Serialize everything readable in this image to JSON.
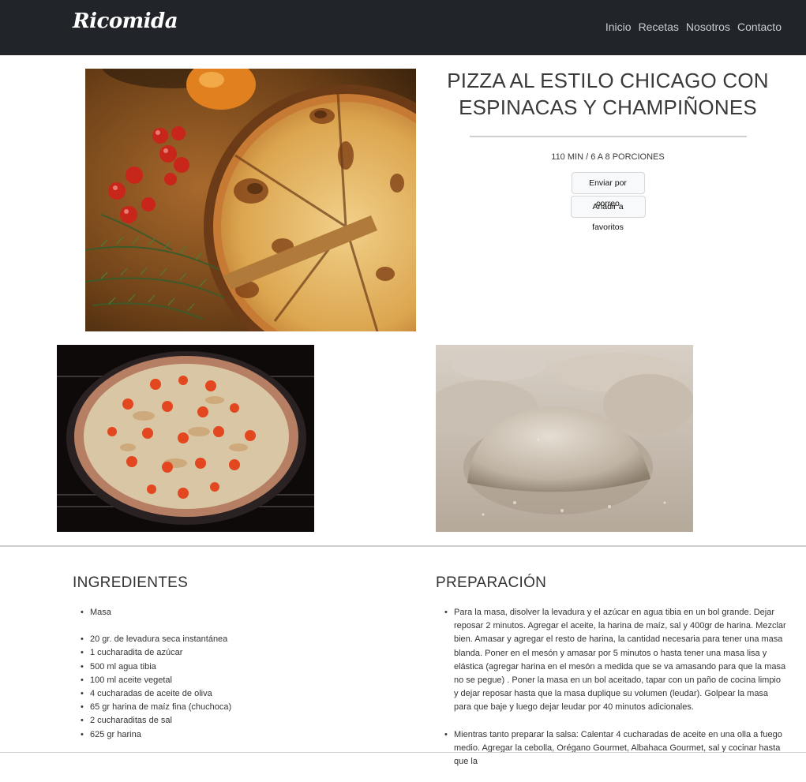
{
  "navbar": {
    "brand": "Ricomida",
    "links": [
      "Inicio",
      "Recetas",
      "Nosotros",
      "Contacto"
    ]
  },
  "recipe": {
    "title": "PIZZA AL ESTILO CHICAGO CON ESPINACAS Y CHAMPIÑONES",
    "meta": "110 MIN / 6 A 8 PORCIONES",
    "email_button": "Enviar por correo",
    "favorite_button": "Añadir a favoritos"
  },
  "ingredients": {
    "title": "INGREDIENTES",
    "items": [
      "Masa",
      "20 gr. de levadura seca instantánea",
      "1 cucharadita de azúcar",
      "500 ml agua tibia",
      "100 ml aceite vegetal",
      "4 cucharadas de aceite de oliva",
      "65 gr harina de maíz fina (chuchoca)",
      "2 cucharaditas de sal",
      "625 gr harina"
    ]
  },
  "preparation": {
    "title": "PREPARACIÓN",
    "steps": [
      "Para la masa, disolver la levadura y el azúcar en agua tibia en un bol grande. Dejar reposar 2 minutos. Agregar el aceite, la harina de maíz, sal y 400gr de harina. Mezclar bien. Amasar y agregar el resto de harina, la cantidad necesaria para tener una masa blanda. Poner en el mesón y amasar por 5 minutos o hasta tener una masa lisa y elástica (agregar harina en el mesón a medida que se va amasando para que la masa no se pegue) . Poner la masa en un bol aceitado, tapar con un paño de cocina limpio y dejar reposar hasta que la masa duplique su volumen (leudar). Golpear la masa para que baje y luego dejar leudar por 40 minutos adicionales.",
      "Mientras tanto preparar la salsa: Calentar 4 cucharadas de aceite en una olla a fuego medio. Agregar la cebolla, Orégano Gourmet, Albahaca Gourmet, sal y cocinar hasta que la"
    ]
  },
  "colors": {
    "navbar_bg": "#212529",
    "brand_text": "#ffffff",
    "nav_link": "#c9ccd0"
  }
}
